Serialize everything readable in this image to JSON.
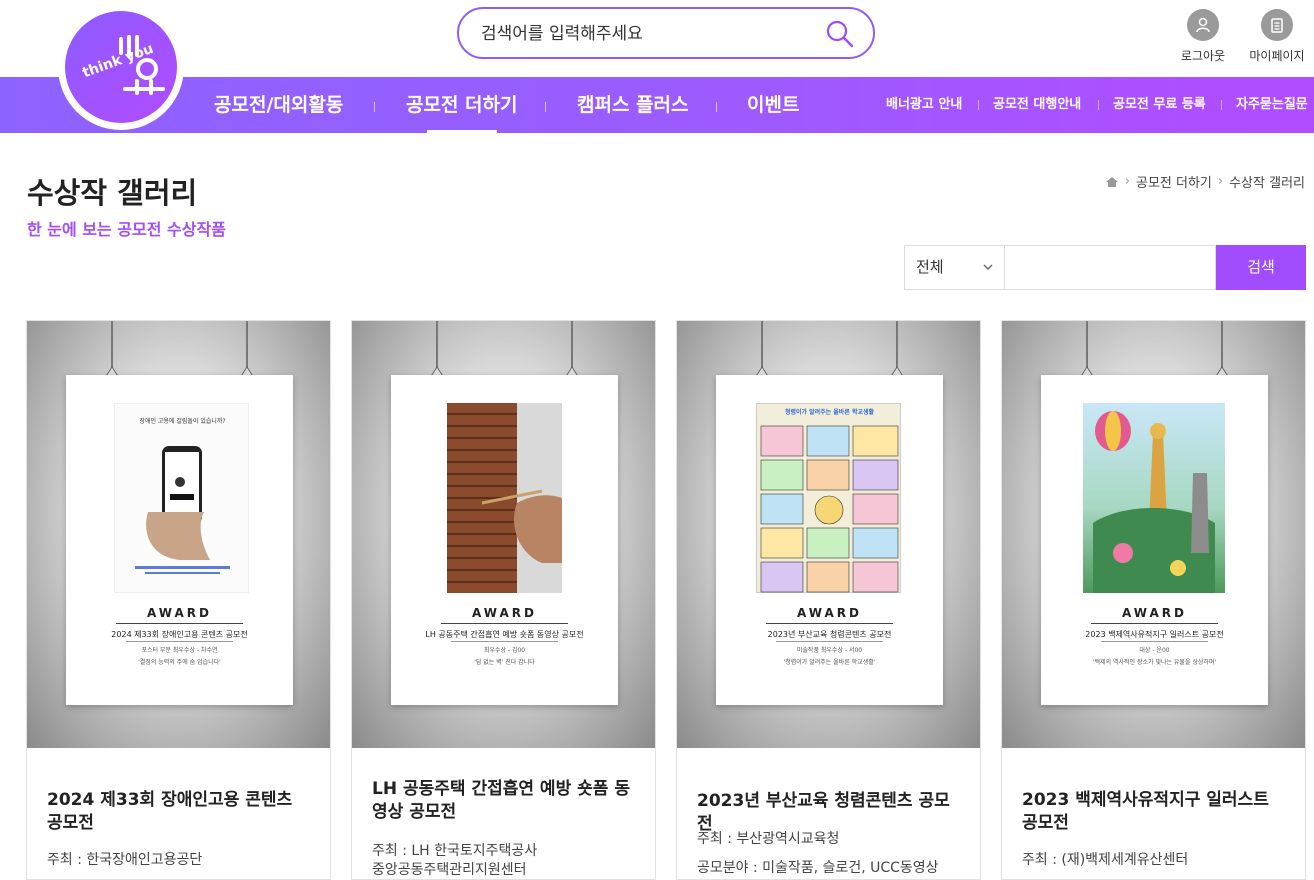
{
  "header": {
    "logo_text": "think you",
    "search_placeholder": "검색어를 입력해주세요",
    "util": [
      {
        "label": "로그아웃",
        "icon": "user-icon"
      },
      {
        "label": "마이페이지",
        "icon": "clipboard-icon"
      }
    ]
  },
  "nav": {
    "main": [
      {
        "label": "공모전/대외활동",
        "active": false
      },
      {
        "label": "공모전 더하기",
        "active": true
      },
      {
        "label": "캠퍼스 플러스",
        "active": false
      },
      {
        "label": "이벤트",
        "active": false
      }
    ],
    "sub": [
      "배너광고 안내",
      "공모전 대행안내",
      "공모전 무료 등록",
      "자주묻는질문"
    ]
  },
  "page": {
    "title": "수상작 갤러리",
    "subtitle": "한 눈에 보는 공모전 수상작품",
    "breadcrumb": [
      "공모전 더하기",
      "수상작 갤러리"
    ]
  },
  "filter": {
    "selected": "전체",
    "button": "검색"
  },
  "colors": {
    "accent": "#a24cff",
    "nav_start": "#8d63ff",
    "nav_end": "#b24cff"
  },
  "cards": [
    {
      "award_title": "2024 제33회 장애인고용 콘텐츠 공모전",
      "award_prize": "포스터 부문 최우수상 - 차수연",
      "award_quote": "'결점의 능력의 주에 숨 업습니다'",
      "art_text": "장애인 고용에 걸림돌이 있습니까?",
      "title": "2024 제33회 장애인고용 콘텐츠 공모전",
      "meta": [
        "주최 : 한국장애인고용공단"
      ]
    },
    {
      "award_title": "LH 공동주택 간접흡연 예방 숏폼 동영상 공모전",
      "award_prize": "최우수상 - 김00",
      "award_quote": "'담 없는 벽' 친다 갑니다",
      "art_text": "",
      "title": "LH 공동주택 간접흡연 예방 숏폼 동영상 공모전",
      "meta": [
        "주최 : LH 한국토지주택공사",
        "중앙공동주택관리지원센터"
      ]
    },
    {
      "award_title": "2023년 부산교육 청렴콘텐츠 공모전",
      "award_prize": "미술작품 최우수상 - 서00",
      "award_quote": "'청렴이가 알려주는 올바른 학교생활'",
      "art_text": "청렴이가 알려주는 올바른 학교생활",
      "title": "2023년 부산교육 청렴콘텐츠 공모전",
      "meta": [
        "주최 : 부산광역시교육청",
        "공모분야 : 미술작품, 슬로건, UCC동영상"
      ]
    },
    {
      "award_title": "2023 백제역사유적지구 일러스트 공모전",
      "award_prize": "대상 - 운00",
      "award_quote": "'백제의 역사적인 장소가 빛나는 유물을 상상하며'",
      "art_text": "",
      "title": "2023 백제역사유적지구 일러스트 공모전",
      "meta": [
        "주최 : (재)백제세계유산센터"
      ]
    }
  ]
}
